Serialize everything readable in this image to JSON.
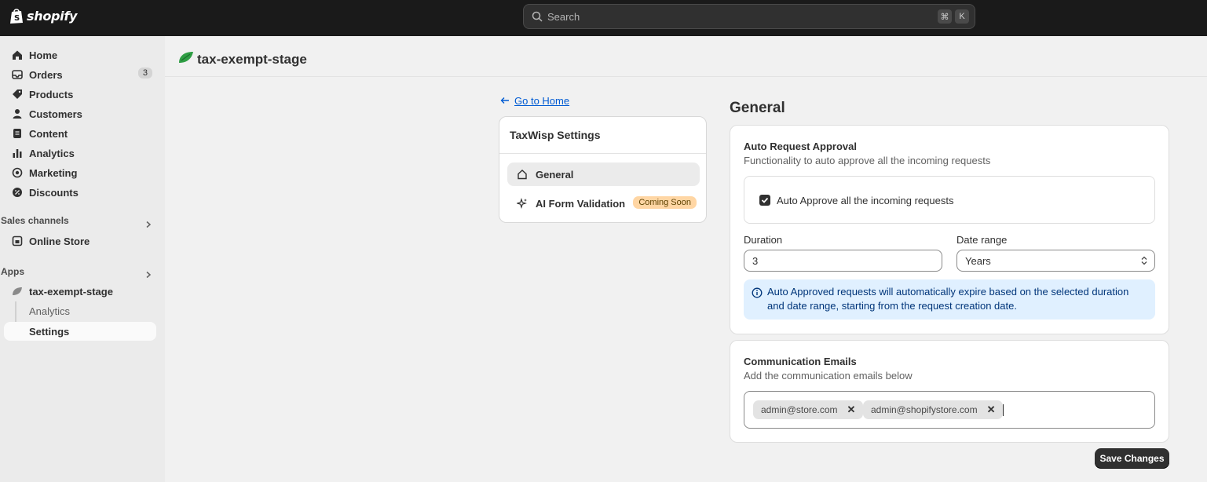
{
  "topbar": {
    "logo_text": "shopify",
    "search_placeholder": "Search",
    "shortcut_cmd": "⌘",
    "shortcut_key": "K"
  },
  "sidebar": {
    "items": [
      {
        "label": "Home",
        "icon": "home-icon"
      },
      {
        "label": "Orders",
        "icon": "inbox-icon",
        "badge": "3"
      },
      {
        "label": "Products",
        "icon": "tag-icon"
      },
      {
        "label": "Customers",
        "icon": "person-icon"
      },
      {
        "label": "Content",
        "icon": "file-icon"
      },
      {
        "label": "Analytics",
        "icon": "bar-chart-icon"
      },
      {
        "label": "Marketing",
        "icon": "target-icon"
      },
      {
        "label": "Discounts",
        "icon": "discount-icon"
      }
    ],
    "sales_channels_label": "Sales channels",
    "online_store_label": "Online Store",
    "apps_label": "Apps",
    "app_name": "tax-exempt-stage",
    "app_sub_analytics": "Analytics",
    "app_sub_settings": "Settings"
  },
  "header": {
    "title": "tax-exempt-stage"
  },
  "settings_nav": {
    "back_label": "Go to Home",
    "title": "TaxWisp Settings",
    "general_label": "General",
    "ai_label": "AI Form Validation",
    "coming_soon": "Coming Soon"
  },
  "main": {
    "title": "General",
    "auto_approval": {
      "title": "Auto Request Approval",
      "subtitle": "Functionality to auto approve all the incoming requests",
      "checkbox_label": "Auto Approve all the incoming requests",
      "checked": true,
      "duration_label": "Duration",
      "duration_value": "3",
      "date_range_label": "Date range",
      "date_range_value": "Years",
      "info_text": "Auto Approved requests will automatically expire based on the selected duration and date range, starting from the request creation date."
    },
    "emails": {
      "title": "Communication Emails",
      "subtitle": "Add the communication emails below",
      "tags": [
        "admin@store.com",
        "admin@shopifystore.com"
      ],
      "remove_symbol": "✕"
    },
    "save_label": "Save Changes"
  },
  "colors": {
    "topbar": "#1a1a1a",
    "accent_link": "#005bd3",
    "badge_coming_soon": "#ffd6a4",
    "info_banner": "#e0f0ff",
    "primary_button": "#303030"
  }
}
